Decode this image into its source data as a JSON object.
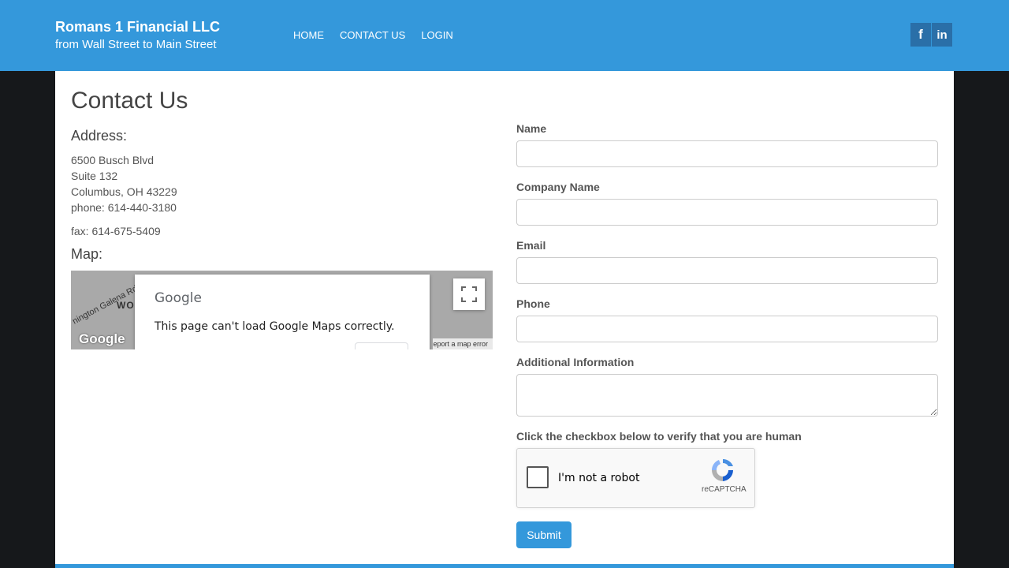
{
  "header": {
    "company": "Romans 1 Financial LLC",
    "tagline": "from Wall Street to Main Street",
    "nav": [
      {
        "label": "HOME"
      },
      {
        "label": "CONTACT US"
      },
      {
        "label": "LOGIN"
      }
    ],
    "social": [
      {
        "icon": "facebook-icon",
        "glyph": "f"
      },
      {
        "icon": "linkedin-icon",
        "glyph": "in"
      }
    ]
  },
  "page": {
    "title": "Contact Us",
    "address_heading": "Address:",
    "address_lines": [
      "6500 Busch Blvd",
      "Suite 132",
      "Columbus, OH 43229",
      "phone: 614-440-3180"
    ],
    "fax": "fax: 614-675-5409",
    "map_heading": "Map:"
  },
  "map": {
    "road_label": "nington Galena Rd",
    "area_label": "WO",
    "google_logo": "Google",
    "dialog_brand": "Google",
    "dialog_message": "This page can't load Google Maps correctly.",
    "error_link": "eport a map error"
  },
  "form": {
    "fields": [
      {
        "label": "Name",
        "value": ""
      },
      {
        "label": "Company Name",
        "value": ""
      },
      {
        "label": "Email",
        "value": ""
      },
      {
        "label": "Phone",
        "value": ""
      },
      {
        "label": "Additional Information",
        "value": ""
      }
    ],
    "captcha_prompt": "Click the checkbox below to verify that you are human",
    "captcha_text": "I'm not a robot",
    "captcha_brand": "reCAPTCHA",
    "submit_label": "Submit"
  },
  "colors": {
    "brand_blue": "#3498db",
    "page_background": "#16181b"
  }
}
